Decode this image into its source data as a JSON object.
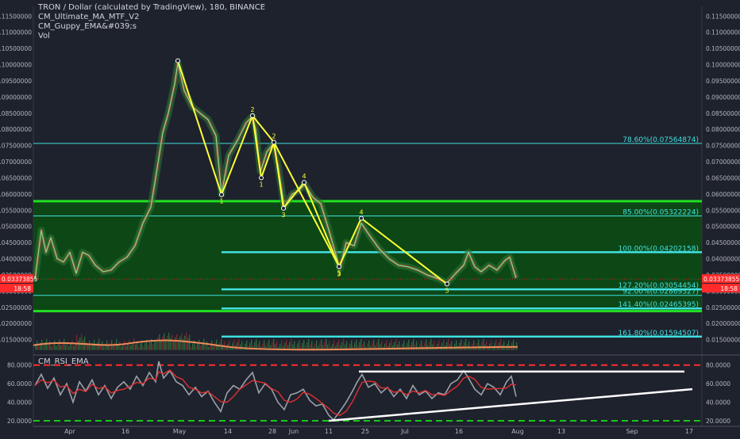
{
  "header": {
    "title": "TRON / Dollar (calculated by TradingView), 180, BINANCE",
    "indicators": [
      "CM_Ultimate_MA_MTF_V2",
      "CM_Guppy_EMA&#039;s",
      "Vol"
    ]
  },
  "rsi": {
    "title": "CM_RSI_EMA"
  },
  "colors": {
    "background": "#1e222d",
    "green_zone": "#0a4d13",
    "bright_green": "#22e022",
    "cyan": "#3fe0e0",
    "yellow": "#ffff33",
    "red_price": "#ff2a2a",
    "rsi_red": "#ff2d2d",
    "rsi_green": "#18c818"
  },
  "current_price": {
    "value": "0.03373855",
    "countdown": "18:58"
  },
  "chart_data": [
    {
      "type": "line",
      "ylim": [
        0.0105,
        0.118
      ],
      "y_ticks": [
        "0.11500000",
        "0.11000000",
        "0.10500000",
        "0.10000000",
        "0.09500000",
        "0.09000000",
        "0.08500000",
        "0.08000000",
        "0.07500000",
        "0.07000000",
        "0.06500000",
        "0.06000000",
        "0.05500000",
        "0.05000000",
        "0.04500000",
        "0.04000000",
        "0.03500000",
        "0.03000000",
        "0.02500000",
        "0.02000000",
        "0.01500000"
      ],
      "y_tick_values": [
        0.115,
        0.11,
        0.105,
        0.1,
        0.095,
        0.09,
        0.085,
        0.08,
        0.075,
        0.07,
        0.065,
        0.06,
        0.055,
        0.05,
        0.045,
        0.04,
        0.035,
        0.03,
        0.025,
        0.02,
        0.015
      ],
      "x_ticks": [
        "Apr",
        "16",
        "May",
        "14",
        "28",
        "Jun",
        "11",
        "25",
        "Jul",
        "16",
        "Aug",
        "13",
        "Sep",
        "17"
      ],
      "price_path": [
        {
          "x": 44,
          "y": 0.0335
        },
        {
          "x": 52,
          "y": 0.0488
        },
        {
          "x": 58,
          "y": 0.042
        },
        {
          "x": 64,
          "y": 0.0465
        },
        {
          "x": 72,
          "y": 0.04
        },
        {
          "x": 80,
          "y": 0.039
        },
        {
          "x": 88,
          "y": 0.042
        },
        {
          "x": 96,
          "y": 0.0355
        },
        {
          "x": 104,
          "y": 0.042
        },
        {
          "x": 112,
          "y": 0.041
        },
        {
          "x": 120,
          "y": 0.038
        },
        {
          "x": 130,
          "y": 0.036
        },
        {
          "x": 140,
          "y": 0.0365
        },
        {
          "x": 150,
          "y": 0.039
        },
        {
          "x": 160,
          "y": 0.0405
        },
        {
          "x": 170,
          "y": 0.044
        },
        {
          "x": 180,
          "y": 0.051
        },
        {
          "x": 190,
          "y": 0.056
        },
        {
          "x": 198,
          "y": 0.068
        },
        {
          "x": 205,
          "y": 0.079
        },
        {
          "x": 212,
          "y": 0.085
        },
        {
          "x": 220,
          "y": 0.094
        },
        {
          "x": 224,
          "y": 0.1005
        },
        {
          "x": 232,
          "y": 0.092
        },
        {
          "x": 242,
          "y": 0.087
        },
        {
          "x": 252,
          "y": 0.085
        },
        {
          "x": 262,
          "y": 0.083
        },
        {
          "x": 272,
          "y": 0.078
        },
        {
          "x": 279,
          "y": 0.06
        },
        {
          "x": 288,
          "y": 0.072
        },
        {
          "x": 300,
          "y": 0.077
        },
        {
          "x": 310,
          "y": 0.082
        },
        {
          "x": 318,
          "y": 0.084
        },
        {
          "x": 322,
          "y": 0.08
        },
        {
          "x": 328,
          "y": 0.067
        },
        {
          "x": 336,
          "y": 0.073
        },
        {
          "x": 344,
          "y": 0.0755
        },
        {
          "x": 350,
          "y": 0.069
        },
        {
          "x": 358,
          "y": 0.056
        },
        {
          "x": 368,
          "y": 0.06
        },
        {
          "x": 376,
          "y": 0.061
        },
        {
          "x": 384,
          "y": 0.063
        },
        {
          "x": 394,
          "y": 0.059
        },
        {
          "x": 404,
          "y": 0.057
        },
        {
          "x": 414,
          "y": 0.049
        },
        {
          "x": 428,
          "y": 0.037
        },
        {
          "x": 436,
          "y": 0.045
        },
        {
          "x": 446,
          "y": 0.044
        },
        {
          "x": 455,
          "y": 0.051
        },
        {
          "x": 466,
          "y": 0.047
        },
        {
          "x": 478,
          "y": 0.043
        },
        {
          "x": 490,
          "y": 0.04
        },
        {
          "x": 502,
          "y": 0.038
        },
        {
          "x": 514,
          "y": 0.0375
        },
        {
          "x": 526,
          "y": 0.0365
        },
        {
          "x": 538,
          "y": 0.035
        },
        {
          "x": 550,
          "y": 0.034
        },
        {
          "x": 563,
          "y": 0.0325
        },
        {
          "x": 574,
          "y": 0.0355
        },
        {
          "x": 584,
          "y": 0.038
        },
        {
          "x": 590,
          "y": 0.042
        },
        {
          "x": 598,
          "y": 0.0375
        },
        {
          "x": 606,
          "y": 0.036
        },
        {
          "x": 616,
          "y": 0.038
        },
        {
          "x": 626,
          "y": 0.0365
        },
        {
          "x": 636,
          "y": 0.0395
        },
        {
          "x": 642,
          "y": 0.0405
        },
        {
          "x": 650,
          "y": 0.034
        }
      ],
      "wave_labels": [
        {
          "label": "1",
          "x": 279,
          "y": 0.0598,
          "pos": "below"
        },
        {
          "label": "2",
          "x": 318,
          "y": 0.0842,
          "pos": "above"
        },
        {
          "label": "1",
          "x": 329,
          "y": 0.065,
          "pos": "below"
        },
        {
          "label": "2",
          "x": 345,
          "y": 0.076,
          "pos": "above"
        },
        {
          "label": "3",
          "x": 357,
          "y": 0.0556,
          "pos": "below"
        },
        {
          "label": "4",
          "x": 383,
          "y": 0.0636,
          "pos": "above"
        },
        {
          "label": "5",
          "x": 427,
          "y": 0.0376,
          "pos": "below"
        },
        {
          "label": "3",
          "x": 427,
          "y": 0.0373,
          "pos": "below"
        },
        {
          "label": "4",
          "x": 455,
          "y": 0.0525,
          "pos": "above"
        },
        {
          "label": "5",
          "x": 563,
          "y": 0.0322,
          "pos": "below"
        }
      ],
      "wave_path": [
        {
          "x": 224,
          "y": 0.1012
        },
        {
          "x": 279,
          "y": 0.0598
        },
        {
          "x": 318,
          "y": 0.0842
        },
        {
          "x": 329,
          "y": 0.065
        },
        {
          "x": 345,
          "y": 0.076
        },
        {
          "x": 357,
          "y": 0.0556
        },
        {
          "x": 383,
          "y": 0.0636
        },
        {
          "x": 427,
          "y": 0.0376
        },
        {
          "x": 455,
          "y": 0.0525
        },
        {
          "x": 563,
          "y": 0.0322
        }
      ],
      "wave_path_alt": [
        {
          "x": 318,
          "y": 0.0842
        },
        {
          "x": 345,
          "y": 0.076
        },
        {
          "x": 427,
          "y": 0.0376
        }
      ],
      "fib_levels": [
        {
          "label": "78.60%(0.07564874)",
          "value": 0.07564874,
          "style": "thin"
        },
        {
          "label": "85.00%(0.05322224)",
          "value": 0.05322224,
          "style": "thin"
        },
        {
          "label": "100.00%(0.04202158)",
          "value": 0.04202158,
          "style": "thick"
        },
        {
          "label": "127.20%(0.03054454)",
          "value": 0.03054454,
          "style": "thick"
        },
        {
          "label": "92.00%(0.02869327)",
          "value": 0.02869327,
          "style": "thin"
        },
        {
          "label": "141.40%(0.02465395)",
          "value": 0.02465395,
          "style": "thick"
        },
        {
          "label": "161.80%(0.01594507)",
          "value": 0.01594507,
          "style": "thick"
        }
      ],
      "green_zone": {
        "top": 0.0578,
        "bottom": 0.0238
      },
      "volume_baseline": 0.0118
    },
    {
      "type": "line",
      "title": "CM_RSI_EMA",
      "ylim": [
        14,
        90
      ],
      "y_ticks": [
        "80.0000",
        "60.0000",
        "40.0000",
        "20.0000"
      ],
      "y_tick_values": [
        80,
        60,
        40,
        20
      ],
      "overbought": 80,
      "oversold": 20,
      "rsi_path": [
        {
          "x": 44,
          "y": 58
        },
        {
          "x": 52,
          "y": 70
        },
        {
          "x": 60,
          "y": 55
        },
        {
          "x": 68,
          "y": 66
        },
        {
          "x": 76,
          "y": 48
        },
        {
          "x": 84,
          "y": 60
        },
        {
          "x": 92,
          "y": 40
        },
        {
          "x": 100,
          "y": 62
        },
        {
          "x": 108,
          "y": 52
        },
        {
          "x": 116,
          "y": 64
        },
        {
          "x": 124,
          "y": 48
        },
        {
          "x": 132,
          "y": 58
        },
        {
          "x": 140,
          "y": 44
        },
        {
          "x": 148,
          "y": 56
        },
        {
          "x": 156,
          "y": 62
        },
        {
          "x": 164,
          "y": 54
        },
        {
          "x": 172,
          "y": 68
        },
        {
          "x": 180,
          "y": 58
        },
        {
          "x": 188,
          "y": 72
        },
        {
          "x": 196,
          "y": 62
        },
        {
          "x": 200,
          "y": 84
        },
        {
          "x": 206,
          "y": 66
        },
        {
          "x": 214,
          "y": 74
        },
        {
          "x": 222,
          "y": 62
        },
        {
          "x": 230,
          "y": 58
        },
        {
          "x": 238,
          "y": 48
        },
        {
          "x": 246,
          "y": 56
        },
        {
          "x": 254,
          "y": 46
        },
        {
          "x": 262,
          "y": 52
        },
        {
          "x": 270,
          "y": 40
        },
        {
          "x": 278,
          "y": 30
        },
        {
          "x": 286,
          "y": 50
        },
        {
          "x": 294,
          "y": 58
        },
        {
          "x": 302,
          "y": 54
        },
        {
          "x": 310,
          "y": 64
        },
        {
          "x": 318,
          "y": 72
        },
        {
          "x": 326,
          "y": 50
        },
        {
          "x": 334,
          "y": 60
        },
        {
          "x": 342,
          "y": 54
        },
        {
          "x": 350,
          "y": 40
        },
        {
          "x": 358,
          "y": 32
        },
        {
          "x": 366,
          "y": 48
        },
        {
          "x": 374,
          "y": 50
        },
        {
          "x": 382,
          "y": 54
        },
        {
          "x": 390,
          "y": 42
        },
        {
          "x": 398,
          "y": 36
        },
        {
          "x": 406,
          "y": 38
        },
        {
          "x": 414,
          "y": 26
        },
        {
          "x": 420,
          "y": 21
        },
        {
          "x": 428,
          "y": 30
        },
        {
          "x": 436,
          "y": 40
        },
        {
          "x": 444,
          "y": 52
        },
        {
          "x": 450,
          "y": 62
        },
        {
          "x": 456,
          "y": 70
        },
        {
          "x": 464,
          "y": 56
        },
        {
          "x": 472,
          "y": 60
        },
        {
          "x": 480,
          "y": 50
        },
        {
          "x": 488,
          "y": 56
        },
        {
          "x": 496,
          "y": 46
        },
        {
          "x": 504,
          "y": 54
        },
        {
          "x": 512,
          "y": 44
        },
        {
          "x": 520,
          "y": 58
        },
        {
          "x": 528,
          "y": 48
        },
        {
          "x": 536,
          "y": 52
        },
        {
          "x": 544,
          "y": 44
        },
        {
          "x": 552,
          "y": 50
        },
        {
          "x": 560,
          "y": 48
        },
        {
          "x": 568,
          "y": 60
        },
        {
          "x": 576,
          "y": 64
        },
        {
          "x": 584,
          "y": 74
        },
        {
          "x": 590,
          "y": 66
        },
        {
          "x": 598,
          "y": 54
        },
        {
          "x": 606,
          "y": 48
        },
        {
          "x": 614,
          "y": 60
        },
        {
          "x": 622,
          "y": 56
        },
        {
          "x": 630,
          "y": 48
        },
        {
          "x": 638,
          "y": 62
        },
        {
          "x": 644,
          "y": 68
        },
        {
          "x": 650,
          "y": 46
        }
      ],
      "trendlines": [
        {
          "from": {
            "x": 452,
            "y": 73
          },
          "to": {
            "x": 862,
            "y": 73
          }
        },
        {
          "from": {
            "x": 414,
            "y": 20
          },
          "to": {
            "x": 872,
            "y": 54
          }
        }
      ]
    }
  ]
}
